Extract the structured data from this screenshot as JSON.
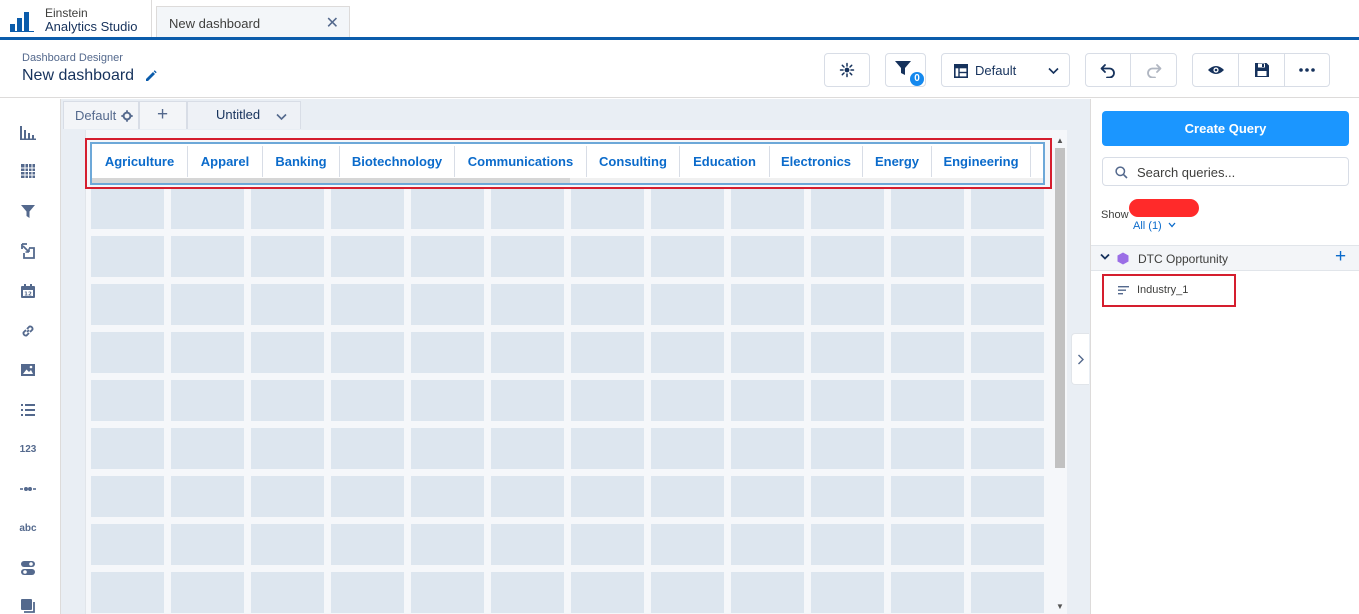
{
  "app": {
    "brand_line1": "Einstein",
    "brand_line2": "Analytics Studio",
    "tab_title": "New dashboard",
    "tab_close_glyph": "✕"
  },
  "header": {
    "breadcrumb": "Dashboard Designer",
    "title": "New dashboard",
    "filter_count": "0",
    "layout_selected": "Default"
  },
  "rail": {
    "number_label": "123",
    "text_label": "abc"
  },
  "canvas": {
    "page_tabs": {
      "default_label": "Default",
      "add_glyph": "+",
      "page_label": "Untitled"
    },
    "list_items": [
      "Agriculture",
      "Apparel",
      "Banking",
      "Biotechnology",
      "Communications",
      "Consulting",
      "Education",
      "Electronics",
      "Energy",
      "Engineering"
    ],
    "grid": {
      "columns": 12,
      "rows": 9
    }
  },
  "panel": {
    "create_label": "Create Query",
    "search_placeholder": "Search queries...",
    "show_label": "Show",
    "show_value": "All (1)",
    "dataset_name": "DTC Opportunity",
    "query_name": "Industry_1"
  },
  "colors": {
    "accent": "#1b96ff",
    "tab_border": "#0b5cab",
    "highlight": "#d51e2e",
    "link": "#0b6bcb",
    "grid_cell": "#dde6ef",
    "dataset_icon": "#9b6ee6"
  }
}
